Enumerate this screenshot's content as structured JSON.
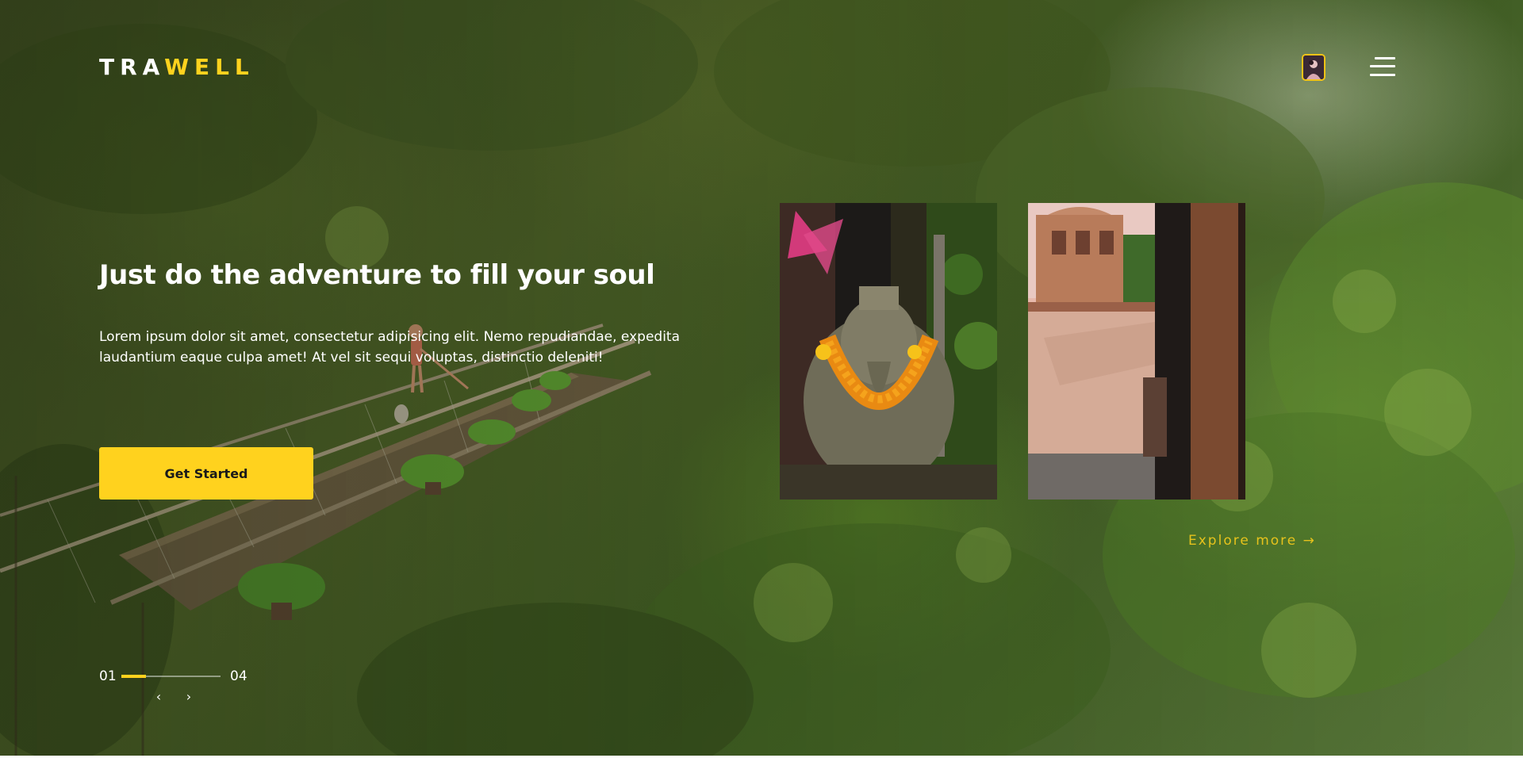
{
  "header": {
    "logo_part1": "TRA",
    "logo_part2": "WELL",
    "avatar_icon": "user-avatar",
    "menu_icon": "hamburger-menu-icon"
  },
  "hero": {
    "title": "Just do the adventure to fill your soul",
    "description": "Lorem ipsum dolor sit amet, consectetur adipisicing elit. Nemo repudiandae, expedita laudantium eaque culpa amet! At vel sit sequi voluptas, distinctio deleniti!",
    "cta_label": "Get Started"
  },
  "slider": {
    "current": "01",
    "total": "04",
    "progress": 0.25,
    "prev_icon": "chevron-left-icon",
    "next_icon": "chevron-right-icon",
    "prev_glyph": "‹",
    "next_glyph": "›"
  },
  "cards": [
    {
      "subject": "ganesha-statue",
      "description": "Ganesha statue with marigold garland"
    },
    {
      "subject": "palace-courtyard",
      "description": "Palace courtyard seen through doorway"
    }
  ],
  "explore": {
    "label": "Explore more →"
  },
  "colors": {
    "accent": "#ffd21e",
    "text": "#ffffff",
    "link": "#e6c21c"
  }
}
